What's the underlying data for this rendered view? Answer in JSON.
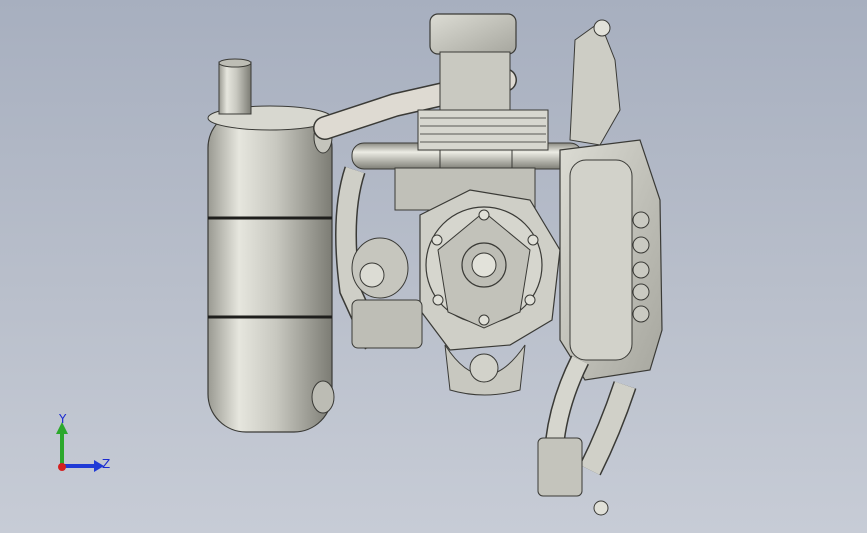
{
  "viewport": {
    "background_top": "#a7afbf",
    "background_bottom": "#c7ccd6",
    "model_fill": "#d4d4cc",
    "model_edge": "#3a3a36"
  },
  "triad": {
    "y_label": "Y",
    "z_label": "Z",
    "y_color": "#2ca82c",
    "z_color": "#1f3ad6",
    "origin_color": "#d42020"
  }
}
